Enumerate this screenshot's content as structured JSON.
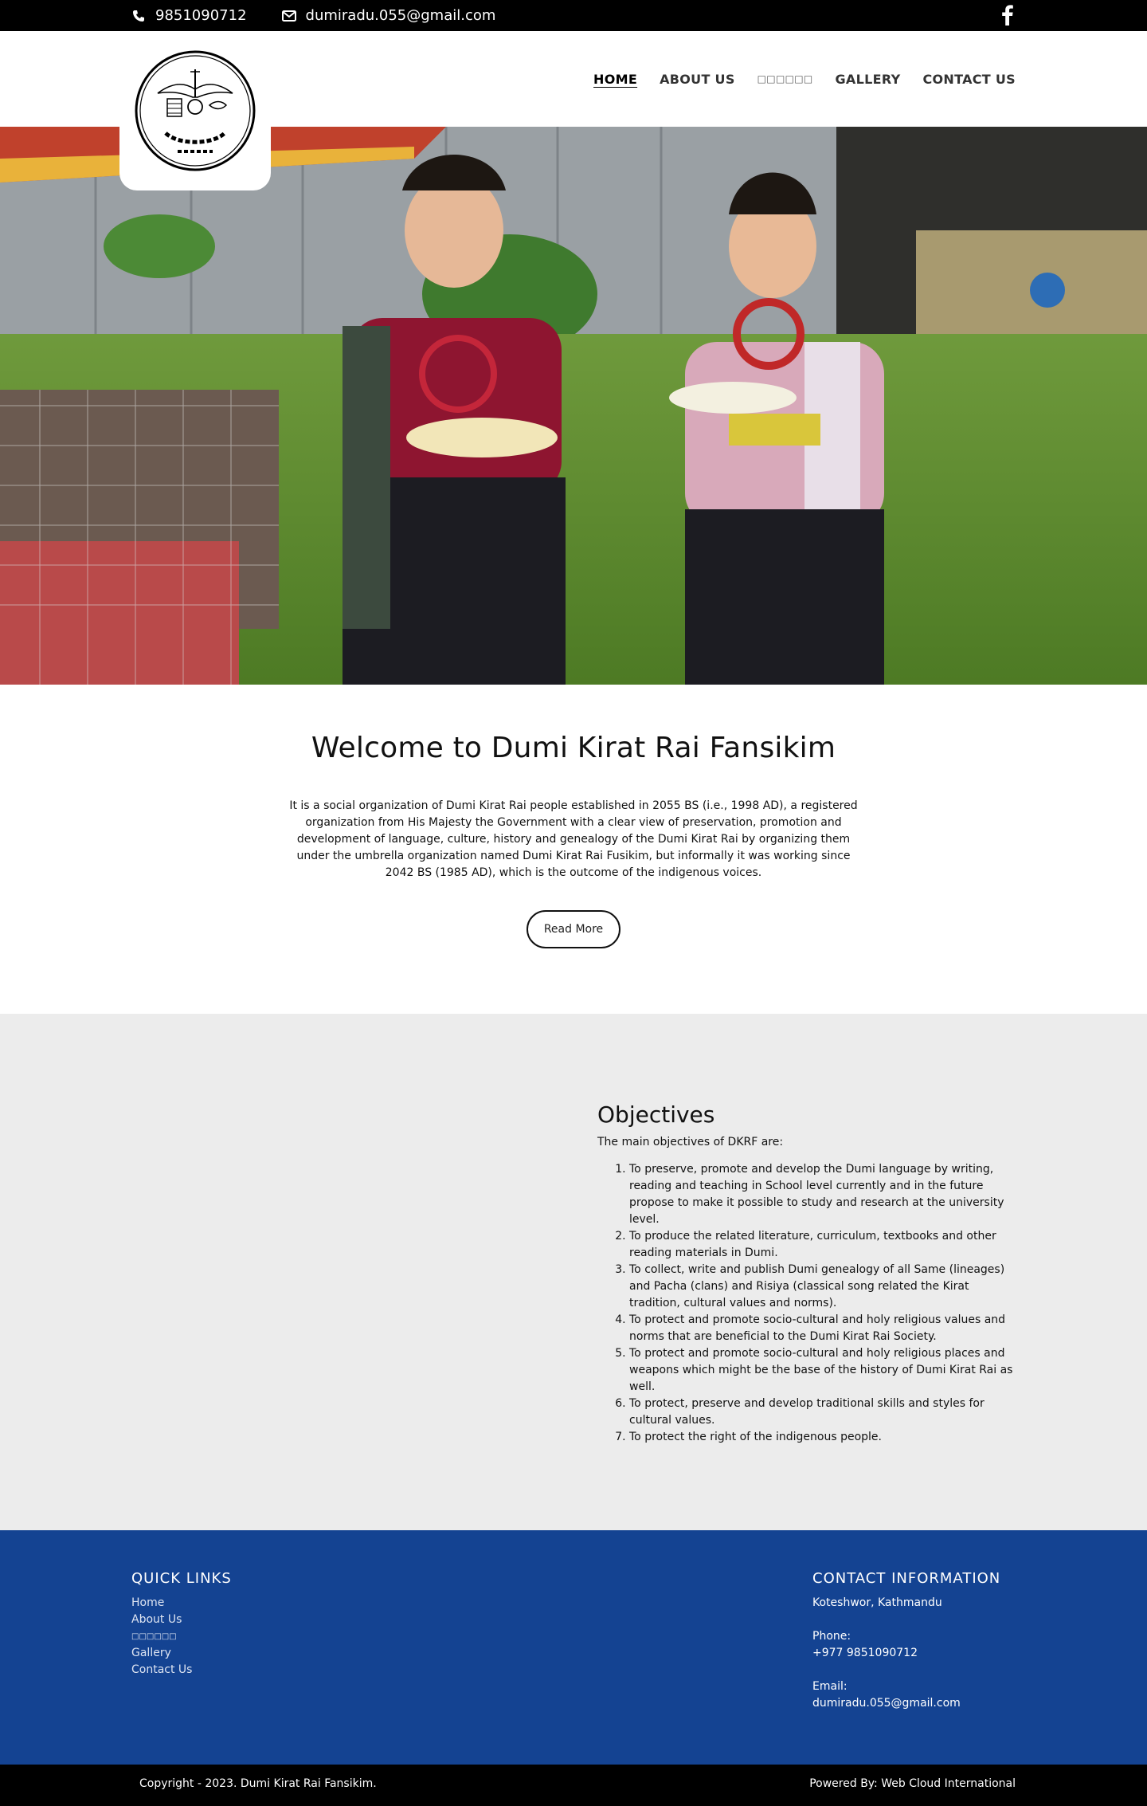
{
  "topbar": {
    "phone": "9851090712",
    "email": "dumiradu.055@gmail.com",
    "phone_icon": "phone-icon",
    "email_icon": "envelope-icon",
    "social_icon": "facebook-icon"
  },
  "logo": {
    "alt": "Dumi Kirat Rai Fansikim logo"
  },
  "nav": {
    "home": "HOME",
    "about": "ABOUT US",
    "nepali": "□□□□□□",
    "gallery": "GALLERY",
    "contact": "CONTACT US"
  },
  "welcome": {
    "title": "Welcome to Dumi Kirat Rai Fansikim",
    "body": "It is a social organization of Dumi Kirat Rai people established in 2055 BS (i.e., 1998 AD), a registered organization from His Majesty the Government with a clear view of preservation, promotion and development of language, culture, history and genealogy of the Dumi Kirat Rai by organizing them under the umbrella organization named Dumi Kirat Rai Fusikim, but informally it was working since 2042 BS (1985 AD), which is the outcome of the indigenous voices.",
    "read_more": "Read More"
  },
  "objectives": {
    "title": "Objectives",
    "intro": "The main objectives of DKRF are:",
    "items": [
      "To preserve, promote and develop the Dumi language by writing, reading and teaching in School level currently and in the future propose to make it possible to study and research at the university level.",
      "To produce the related literature, curriculum, textbooks and other reading materials in Dumi.",
      "To collect, write and publish Dumi genealogy of all Same (lineages) and Pacha (clans) and Risiya (classical song related the Kirat tradition, cultural values and norms).",
      "To protect and promote socio-cultural and holy religious values and norms that are beneficial to the Dumi Kirat Rai Society.",
      "To protect and promote socio-cultural and holy religious places and weapons which might be the base of the history of Dumi Kirat Rai as well.",
      "To protect, preserve and develop traditional skills and styles for cultural values.",
      "To protect the right of the indigenous people."
    ]
  },
  "footer": {
    "quick_links_title": "QUICK LINKS",
    "links": [
      "Home",
      "About Us",
      "□□□□□□",
      "Gallery",
      "Contact Us"
    ],
    "contact_title": "CONTACT INFORMATION",
    "address": "Koteshwor, Kathmandu",
    "phone_label": "Phone:",
    "phone": "+977 9851090712",
    "email_label": "Email:",
    "email": "dumiradu.055@gmail.com"
  },
  "copyright": {
    "left": "Copyright - 2023. Dumi Kirat Rai Fansikim.",
    "right": "Powered By: Web Cloud International"
  },
  "colors": {
    "topbar": "#000000",
    "footer": "#144392",
    "objectives_bg": "#ececec"
  }
}
